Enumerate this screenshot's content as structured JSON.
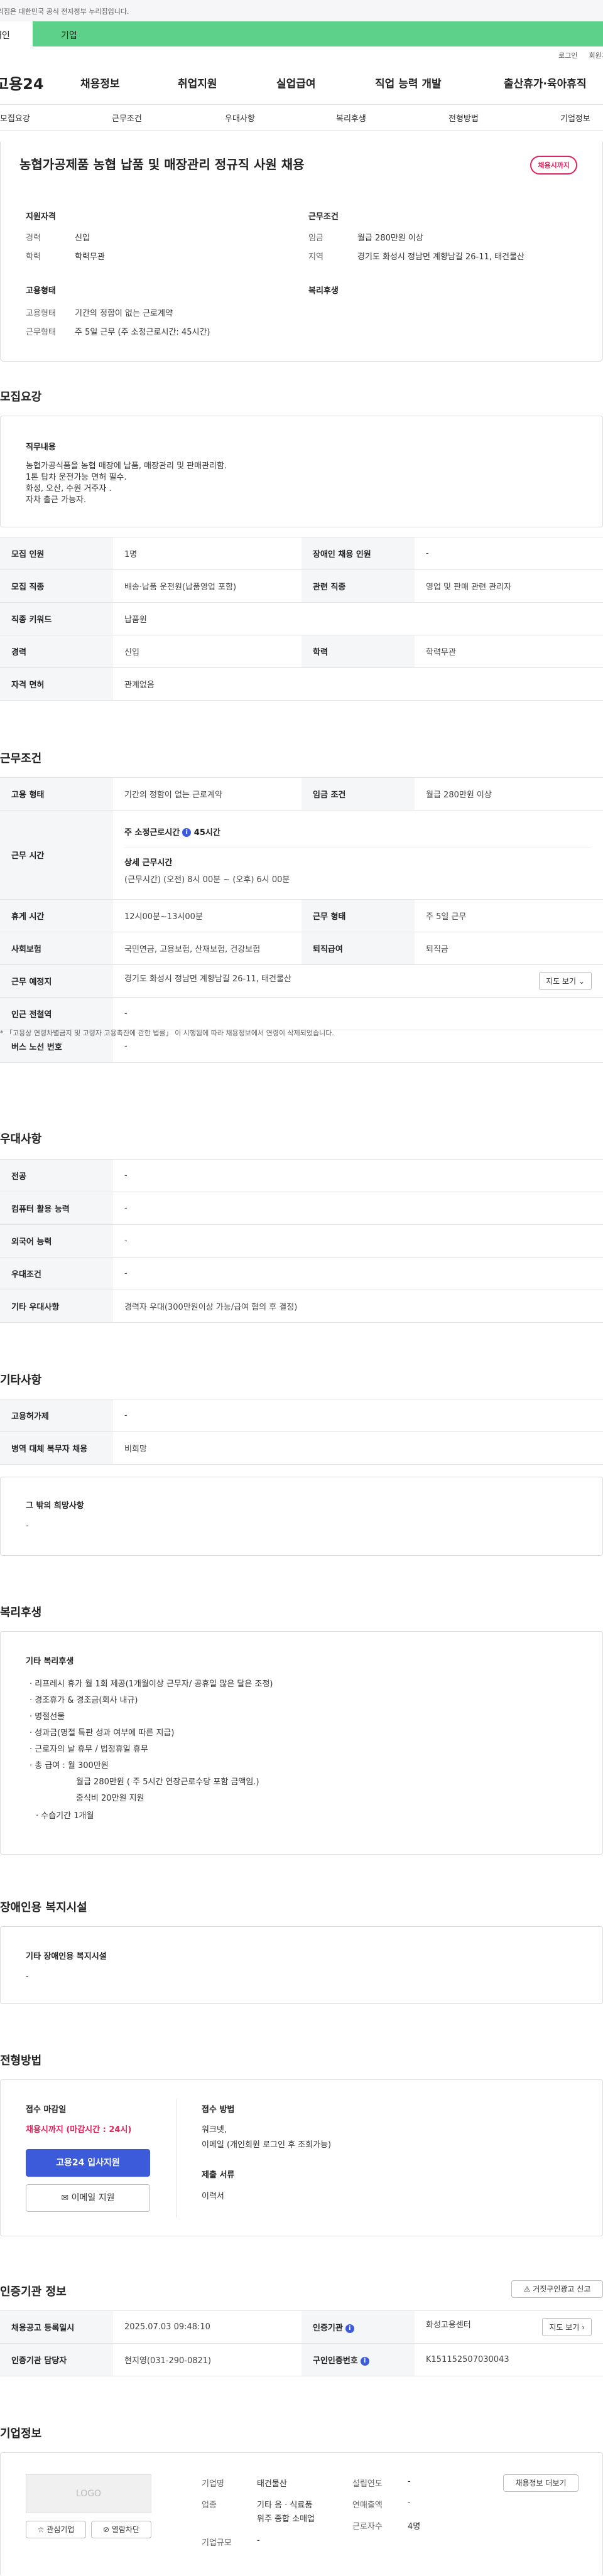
{
  "top": {
    "notice": "이 누리집은 대한민국 공식 전자정부 누리집입니다.",
    "tab_personal": "개인",
    "tab_company": "기업",
    "login": "로그인",
    "join": "회원가입"
  },
  "gnb": {
    "logo": "고용24",
    "menu": [
      "채용정보",
      "취업지원",
      "실업급여",
      "직업 능력 개발",
      "출산휴가·육아휴직"
    ]
  },
  "subnav": [
    "모집요강",
    "근무조건",
    "우대사항",
    "복리후생",
    "전형방법",
    "기업정보"
  ],
  "job": {
    "title": "농협가공제품 농협 납품 및 매장관리 정규직 사원 채용",
    "badge": "채용시까지",
    "qual_h": "지원자격",
    "career_k": "경력",
    "career_v": "신입",
    "edu_k": "학력",
    "edu_v": "학력무관",
    "cond_h": "근무조건",
    "pay_k": "임금",
    "pay_v": "월급 280만원 이상",
    "area_k": "지역",
    "area_v": "경기도 화성시 정남면 계향남길 26-11, 태건물산",
    "emp_h": "고용형태",
    "emptype_k": "고용형태",
    "emptype_v": "기간의 정함이 없는 근로계약",
    "worktype_k": "근무형태",
    "worktype_v": "주 5일 근무 (주 소정근로시간: 45시간)",
    "welfare_h": "복리후생"
  },
  "recruit": {
    "title": "모집요강",
    "duty_h": "직무내용",
    "duty_lines": [
      "농협가공식품을 농협 매장에 납품, 매장관리 및 판매관리함.",
      "1톤 탑차 운전가능 면허 필수.",
      "화성, 오산, 수원 거주자 .",
      "자차 출근 가능자."
    ],
    "rows": [
      [
        "모집 인원",
        "1명",
        "장애인 채용 인원",
        "-"
      ],
      [
        "모집 직종",
        "배송·납품 운전원(납품영업 포함)",
        "관련 직종",
        "영업 및 판매 관련 관리자"
      ],
      [
        "직종 키워드",
        "납품원",
        "",
        ""
      ],
      [
        "경력",
        "신입",
        "학력",
        "학력무관"
      ],
      [
        "자격 면허",
        "관계없음",
        "",
        ""
      ]
    ]
  },
  "work": {
    "title": "근무조건",
    "r1": [
      "고용 형태",
      "기간의 정함이 없는 근로계약",
      "임금 조건",
      "월급 280만원 이상"
    ],
    "hours_k": "근무 시간",
    "hours_main": "주 소정근로시간",
    "hours_val": "45시간",
    "detail_h": "상세 근무시간",
    "detail_v": "(근무시간) (오전) 8시 00분 ~ (오후) 6시 00분",
    "r3": [
      "휴게 시간",
      "12시00분~13시00분",
      "근무 형태",
      "주 5일 근무"
    ],
    "r4": [
      "사회보험",
      "국민연금, 고용보험, 산재보험, 건강보험",
      "퇴직급여",
      "퇴직금"
    ],
    "place_k": "근무 예정지",
    "place_v": "경기도 화성시 정남면 계향남길 26-11, 태건물산",
    "map_btn": "지도 보기",
    "subway_k": "인근 전철역",
    "subway_v": "-",
    "bus_k": "버스 노선 번호",
    "bus_v": "-",
    "note": "* 「고용상 연령차별금지 및 고령자 고용촉진에 관한 법률」 이 시행됨에 따라 채용정보에서 연령이 삭제되었습니다."
  },
  "pref": {
    "title": "우대사항",
    "rows": [
      [
        "전공",
        "-"
      ],
      [
        "컴퓨터 활용 능력",
        "-"
      ],
      [
        "외국어 능력",
        "-"
      ],
      [
        "우대조건",
        "-"
      ],
      [
        "기타 우대사항",
        "경력자 우대(300만원이상 가능/급여 협의 후 결정)"
      ]
    ]
  },
  "etc": {
    "title": "기타사항",
    "rows": [
      [
        "고용허가제",
        "-"
      ],
      [
        "병역 대체 복무자 채용",
        "비희망"
      ]
    ],
    "hope_h": "그 밖의 희망사항",
    "hope_v": "-"
  },
  "welfare": {
    "title": "복리후생",
    "box_h": "기타 복리후생",
    "lines": [
      "· 리프레시 휴가 월 1회 제공(1개월이상 근무자/ 공휴일 많은 달은 조정)",
      "· 경조휴가 & 경조금(회사 내규)",
      "· 명절선물",
      "· 성과금(명절 특판 성과 여부에 따른 지급)",
      "· 근로자의 날 휴무 / 법정휴일 휴무",
      "· 총 급여 : 월 300만원",
      "월급 280만원 ( 주 5시간 연장근로수당 포함 금액임.)",
      "중식비 20만원 지원",
      "· 수습기간 1개월"
    ]
  },
  "disabled": {
    "title": "장애인용 복지시설",
    "box_h": "기타 장애인용 복지시설",
    "box_v": "-"
  },
  "apply": {
    "title": "전형방법",
    "deadline_h": "접수 마감일",
    "deadline_v": "채용시까지 (마감시간 : 24시)",
    "apply_btn": "고용24 입사지원",
    "email_btn": "이메일 지원",
    "method_h": "접수 방법",
    "method_lines": [
      "워크넷,",
      "이메일 (개인회원 로그인 후 조회가능)"
    ],
    "docs_h": "제출 서류",
    "docs_v": "이력서"
  },
  "agency": {
    "title": "인증기관 정보",
    "report_btn": "거짓구인광고 신고",
    "r1": [
      "채용공고 등록일시",
      "2025.07.03 09:48:10",
      "인증기관",
      "화성고용센터"
    ],
    "r2": [
      "인증기관 담당자",
      "현지영(031-290-0821)",
      "구인인증번호",
      "K151152507030043"
    ],
    "map_btn": "지도 보기"
  },
  "company": {
    "title": "기업정보",
    "logo": "LOGO",
    "fav_btn": "관심기업",
    "block_btn": "열람차단",
    "more_btn": "채용정보 더보기",
    "name_k": "기업명",
    "name_v": "태건물산",
    "industry_k": "업종",
    "industry_lines": [
      "기타 음 · 식료품",
      "위주 종합 소매업"
    ],
    "scale_k": "기업규모",
    "scale_v": "-",
    "found_k": "설립연도",
    "found_v": "-",
    "sales_k": "연매출액",
    "sales_v": "-",
    "emp_k": "근로자수",
    "emp_v": "4명"
  }
}
